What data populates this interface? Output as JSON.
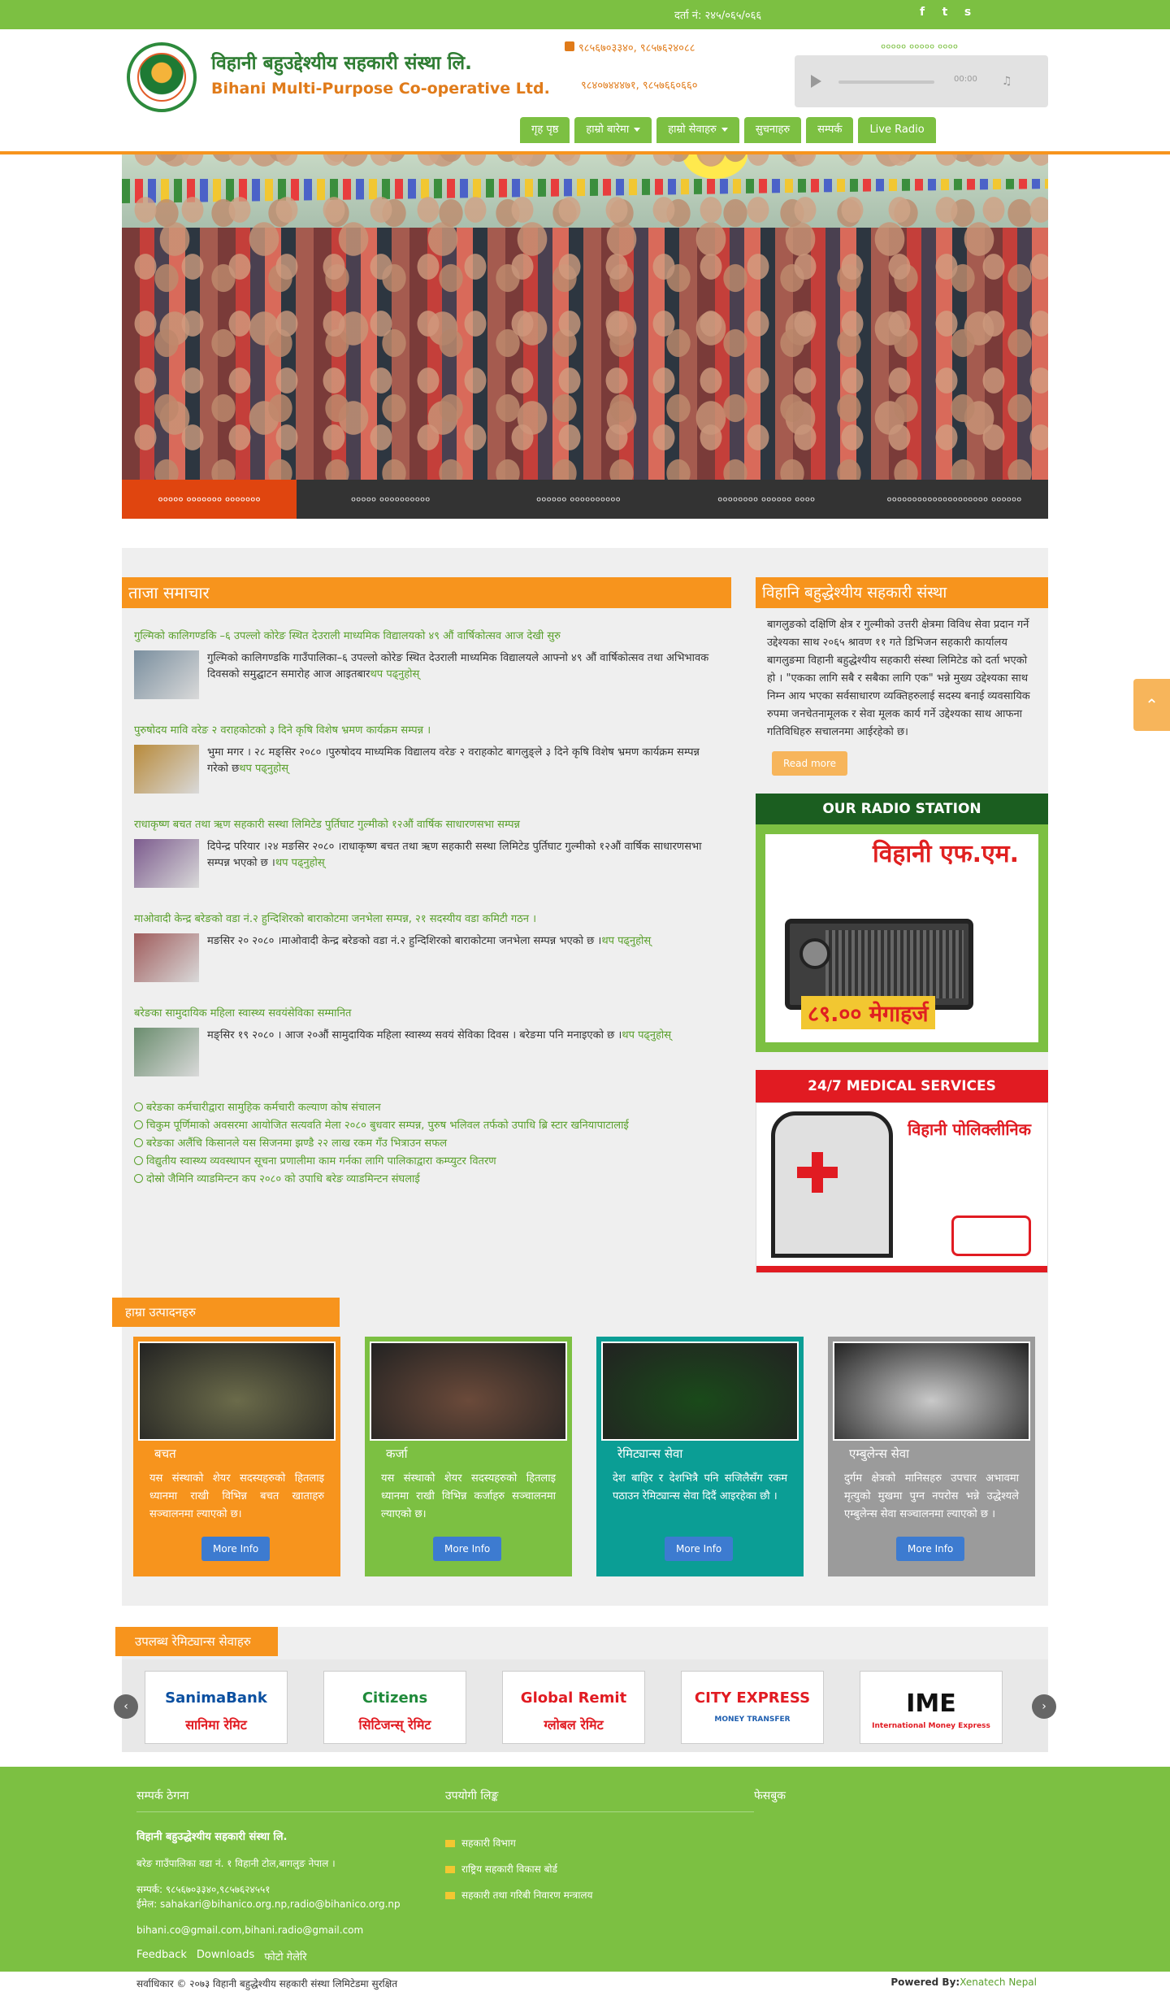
{
  "topbar": {
    "reg_no": "दर्ता नं: २४५/०६५/०६६",
    "social": [
      {
        "icon": "facebook-icon",
        "glyph": "f"
      },
      {
        "icon": "twitter-icon",
        "glyph": "t"
      },
      {
        "icon": "skype-icon",
        "glyph": "s"
      }
    ]
  },
  "header": {
    "brand_np": "विहानी बहुउद्देश्यीय सहकारी संस्था लि.",
    "brand_en": "Bihani Multi-Purpose Co-operative Ltd.",
    "phone_line1": "९८५६७०३३४०, ९८५७६२४०८८",
    "phone_line2": "९८४०७४४४७१, ९८५७६६०६६०",
    "radio_label": "००००० ००००० ००००",
    "player_time": "00:00"
  },
  "nav": [
    {
      "label": "गृह पृष्ठ",
      "dropdown": false
    },
    {
      "label": "हाम्रो बारेमा",
      "dropdown": true
    },
    {
      "label": "हाम्रो सेवाहरु",
      "dropdown": true
    },
    {
      "label": "सुचनाहरु",
      "dropdown": false
    },
    {
      "label": "सम्पर्क",
      "dropdown": false
    },
    {
      "label": "Live Radio",
      "dropdown": false
    }
  ],
  "tabs": [
    "००००० ००००००० ०००००००",
    "००००० ००००००००००",
    "०००००० ००००००००००",
    "०००००००० ०००००० ००००",
    "०००००००००००००००००००० ००००००"
  ],
  "news_section": {
    "title": "ताजा समाचार",
    "items": [
      {
        "title": "गुल्मिको कालिगण्डकि –६ उपल्लो कोरेङ स्थित देउराली माध्यमिक विद्यालयको ४९ औं वार्षिकोत्सव आज देखी सुरु",
        "text": "गुल्मिको कालिगण्डकि गाउँपालिका–६ उपल्लो कोरेङ स्थित देउराली माध्यमिक विद्यालयले आफ्नो ४९ औं वार्षिकोत्सव तथा अभिभावक दिवसको समुद्घाटन समारोह आज आइतबार",
        "more": "थप पढ्नुहोस्",
        "thumb": "#7a8f9f"
      },
      {
        "title": "पुरुषोदय मावि वरेङ २ वराहकोटको ३ दिने कृषि विशेष भ्रमण कार्यक्रम सम्पन्न ।",
        "text": "भुमा मगर । २८ मङ्सिर २०८० ।पुरुषोदय माध्यमिक विद्यालय वरेङ २ वराहकोट बागलुङ्ले ३ दिने कृषि विशेष भ्रमण कार्यक्रम सम्पन्न गरेको छ",
        "more": "थप पढ्नुहोस्",
        "thumb": "#b88a3a"
      },
      {
        "title": "राधाकृष्ण बचत तथा ऋण सहकारी सस्था लिमिटेड पुर्तिघाट गुल्मीको १२औं वार्षिक साधारणसभा सम्पन्न",
        "text": "दिपेन्द्र परियार ।२४ मङसिर २०८० ।राधाकृष्ण बचत तथा ऋण सहकारी सस्था लिमिटेड पुर्तिघाट गुल्मीको १२औं वार्षिक साधारणसभा सम्पन्न भएको छ ।",
        "more": "थप पढ्नुहोस्",
        "thumb": "#7c5b8e"
      },
      {
        "title": "माओवादी केन्द्र बरेङको वडा नं.२ हुन्दिशिरको बाराकोटमा जनभेला सम्पन्न, २१ सदस्यीय वडा कमिटी गठन ।",
        "text": "मङसिर २० २०८० ।माओवादी केन्द्र बरेङको वडा नं.२ हुन्दिशिरको बाराकोटमा जनभेला सम्पन्न भएको छ ।",
        "more": "थप पढ्नुहोस्",
        "thumb": "#a05c5c"
      },
      {
        "title": "बरेङका सामुदायिक महिला स्वास्थ्य सवयंसेविका सम्मानित",
        "text": "मङ्सिर १९ २०८० । आज २०औं सामुदायिक महिला स्वास्थ्य सवयं सेविका दिवस । बरेङमा पनि मनाइएको छ ।",
        "more": "थप पढ्नुहोस्",
        "thumb": "#6a8d6e"
      }
    ],
    "bullets": [
      "बरेङका कर्मचारीद्वारा सामुहिक कर्मचारी कल्याण कोष संचालन",
      "चिकुम पूर्णिमाको अवसरमा आयोजित सत्यवति मेला २०८० बुधवार सम्पन्न, पुरुष भलिवल तर्फको उपाधि ब्रि स्टार खनियापाटालाई",
      "बरेङका अलैंचि किसानले यस सिजनमा झण्डै २२ लाख रकम गँउ भित्राउन सफल",
      "विद्युतीय स्वास्थ्य व्यवस्थापन सूचना प्रणालीमा काम गर्नका लागि पालिकाद्वारा कम्प्युटर वितरण",
      "दोस्रो जैमिनि व्याडमिन्टन कप २०८० को उपाधि बरेङ व्याडमिन्टन संघलाई"
    ]
  },
  "about": {
    "title": "विहानि बहुद्धेश्यीय सहकारी संस्था",
    "text": "बागलुङको दक्षिणि क्षेत्र र गुल्मीको उत्तरी क्षेत्रमा विविध सेवा प्रदान गर्ने उद्देश्यका साथ २०६५ श्रावण ११ गते डिभिजन सहकारी कार्यालय बागलुङमा विहानी बहुद्धेश्यीय सहकारी संस्था लिमिटेड को दर्ता भएको हो । \"एकका लागि सबै र सबैका लागि एक\" भन्ने मुख्य उद्देश्यका साथ निम्न आय भएका सर्वसाधारण व्यक्तिहरुलाई सदस्य बनाई व्यवसायिक रुपमा जनचेतनामूलक र सेवा मूलक कार्य गर्ने उद्देश्यका साथ आफना गतिविधिहरु सचालनमा आईरहेको छ।",
    "read_more": "Read more"
  },
  "radio": {
    "heading": "OUR RADIO STATION",
    "station": "विहानी एफ.एम.",
    "frequency": "८९.०० मेगाहर्ज"
  },
  "medical": {
    "heading": "24/7 MEDICAL SERVICES",
    "clinic": "विहानी पोलिक्लीनिक"
  },
  "products": {
    "heading": "हाम्रा उत्पादनहरु",
    "items": [
      {
        "name": "बचत",
        "desc": "यस संस्थाको शेयर सदस्यहरुको हितलाइ ध्यानमा राखी विभिन्न बचत खाताहरु सञ्चालनमा ल्याएको छ।",
        "btn": "More Info",
        "bg": "#f7941d",
        "pic": "#6b6b4a"
      },
      {
        "name": "कर्जा",
        "desc": "यस संस्थाको शेयर सदस्यहरुको हितलाइ ध्यानमा राखी विभिन्न कर्जाहरु सञ्चालनमा ल्याएको छ।",
        "btn": "More Info",
        "bg": "#7cc042",
        "pic": "#6b4a3a"
      },
      {
        "name": "रेमिट्यान्स सेवा",
        "desc": "देश बाहिर र देशभित्रै पनि सजिलैसँग रकम पठाउन रेमिट्यान्स सेवा दिदैं आइरहेका छौ ।",
        "btn": "More Info",
        "bg": "#0b9e95",
        "pic": "#1a4a1a"
      },
      {
        "name": "एम्बुलेन्स सेवा",
        "desc": "दुर्गम क्षेत्रको मानिसहरु उपचार अभावमा मृत्युको मुखमा पुग्न नपरोस भन्ने उद्धेश्यले एम्बुलेन्स सेवा सञ्चालनमा ल्याएको छ ।",
        "btn": "More Info",
        "bg": "#9b9b9b",
        "pic": "#c9c9c9"
      }
    ]
  },
  "remit": {
    "heading": "उपलब्ध रेमिट्यान्स सेवाहरु",
    "logos": [
      {
        "name": "SanimaBank",
        "sub": "सानिमा रेमिट",
        "color": "#0a4fa0",
        "sub_color": "#e11b22"
      },
      {
        "name": "Citizens",
        "sub": "सिटिजन्स् रेमिट",
        "color": "#1f8a3a",
        "sub_color": "#e11b22"
      },
      {
        "name": "Global Remit",
        "sub": "ग्लोबल रेमिट",
        "color": "#e11b22",
        "sub_color": "#e11b22"
      },
      {
        "name": "CITY EXPRESS",
        "sub": "MONEY TRANSFER",
        "color": "#e11b22",
        "sub_color": "#1f5fb0"
      },
      {
        "name": "IME",
        "sub": "International Money Express",
        "color": "#111111",
        "sub_color": "#e11b22"
      }
    ]
  },
  "footer": {
    "contact_title": "सम्पर्क ठेगना",
    "org": "विहानी बहुउद्धेश्यीय सहकारी संस्था लि.",
    "address": "बरेङ गाउँपालिका वडा नं. १ विहानी टोल,बागलुङ नेपाल ।",
    "phone": "सम्पर्क: ९८५६७०३३४०,९८५७६२४५५१",
    "email": "ईमेल: sahakari@bihanico.org.np,radio@bihanico.org.np",
    "gmail": "bihani.co@gmail.com,bihani.radio@gmail.com",
    "links_title": "उपयोगी लिङ्क",
    "links": [
      "सहकारी विभाग",
      "राष्ट्रिय सहकारी विकास बोर्ड",
      "सहकारी तथा गरिबी निवारण मन्त्रालय"
    ],
    "facebook_title": "फेसबुक",
    "bottom_links": [
      "Feedback",
      "Downloads",
      "फोटो गेलेरि"
    ],
    "copyright": "सर्वाधिकार © २०७३ विहानी बहुद्धेश्यीय सहकारी संस्था लिमिटेडमा सुरक्षित",
    "powered_label": "Powered By:",
    "powered_by": "Xenatech Nepal"
  }
}
